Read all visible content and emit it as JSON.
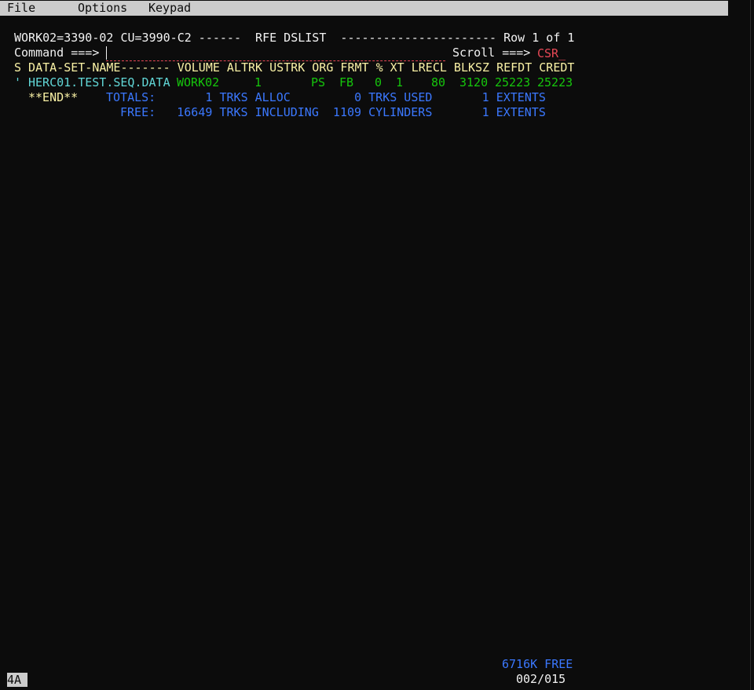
{
  "menu": {
    "file": "File",
    "options": "Options",
    "keypad": "Keypad"
  },
  "header": {
    "volume_info": "WORK02=3390-02 CU=3990-C2 ------  RFE DSLIST  ---------------------- Row 1 of 1"
  },
  "command": {
    "label": "Command ===>",
    "value": "",
    "scroll_label": "Scroll ===>",
    "scroll_value": "CSR_"
  },
  "table": {
    "header": "S DATA-SET-NAME------- VOLUME ALTRK USTRK ORG FRMT % XT LRECL BLKSZ REFDT CREDT",
    "rows": [
      {
        "sel": "'",
        "dsname": "HERC01.TEST.SEQ.DATA",
        "volume": "WORK02",
        "altrk": "1",
        "ustrk": "",
        "org": "PS",
        "frmt": "FB",
        "pct": "0",
        "xt": "1",
        "lrecl": "80",
        "blksz": "3120",
        "refdt": "25223",
        "credt": "25223"
      }
    ],
    "end_marker": "**END**",
    "totals_line": "TOTALS:       1 TRKS ALLOC         0 TRKS USED       1 EXTENTS",
    "free_line": "FREE:   16649 TRKS INCLUDING  1109 CYLINDERS       1 EXTENTS"
  },
  "footer": {
    "free_memory": "6716K FREE",
    "position": "002/015",
    "status": "4A"
  },
  "colors": {
    "background": "#0c0c0c",
    "white": "#f2f2f2",
    "yellow": "#f9f1a5",
    "cyan": "#61d6d6",
    "green": "#16c60c",
    "blue": "#3b78ff",
    "red": "#e74856",
    "menubar": "#cccccc"
  }
}
